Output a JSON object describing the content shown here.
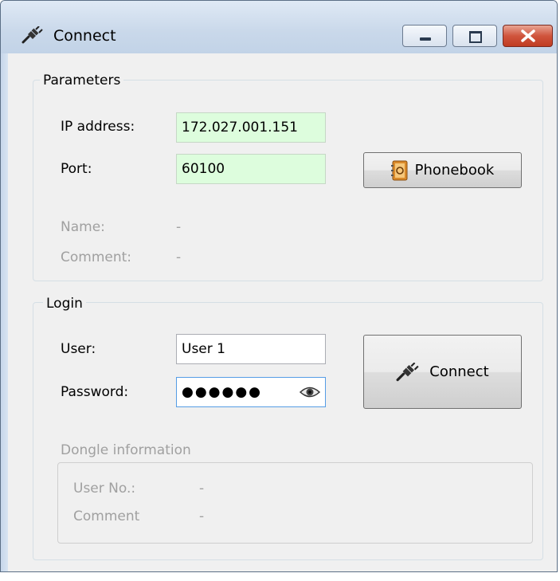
{
  "window": {
    "title": "Connect",
    "icon": "plug-icon",
    "controls": [
      "minimize-icon",
      "maximize-icon",
      "close-icon"
    ]
  },
  "parameters": {
    "group_label": "Parameters",
    "ip_label": "IP address:",
    "ip_value": "172.027.001.151",
    "port_label": "Port:",
    "port_value": "60100",
    "phonebook_label": "Phonebook",
    "name_label": "Name:",
    "name_value": "-",
    "comment_label": "Comment:",
    "comment_value": "-"
  },
  "login": {
    "group_label": "Login",
    "user_label": "User:",
    "user_value": "User 1",
    "password_label": "Password:",
    "password_masked": "●●●●●●",
    "connect_label": "Connect",
    "dongle": {
      "group_label": "Dongle information",
      "user_no_label": "User No.:",
      "user_no_value": "-",
      "comment_label": "Comment",
      "comment_value": "-"
    }
  },
  "colors": {
    "valid_field_bg": "#ddfddd",
    "close_button": "#c74a33",
    "disabled_text": "#a0a0a0"
  }
}
